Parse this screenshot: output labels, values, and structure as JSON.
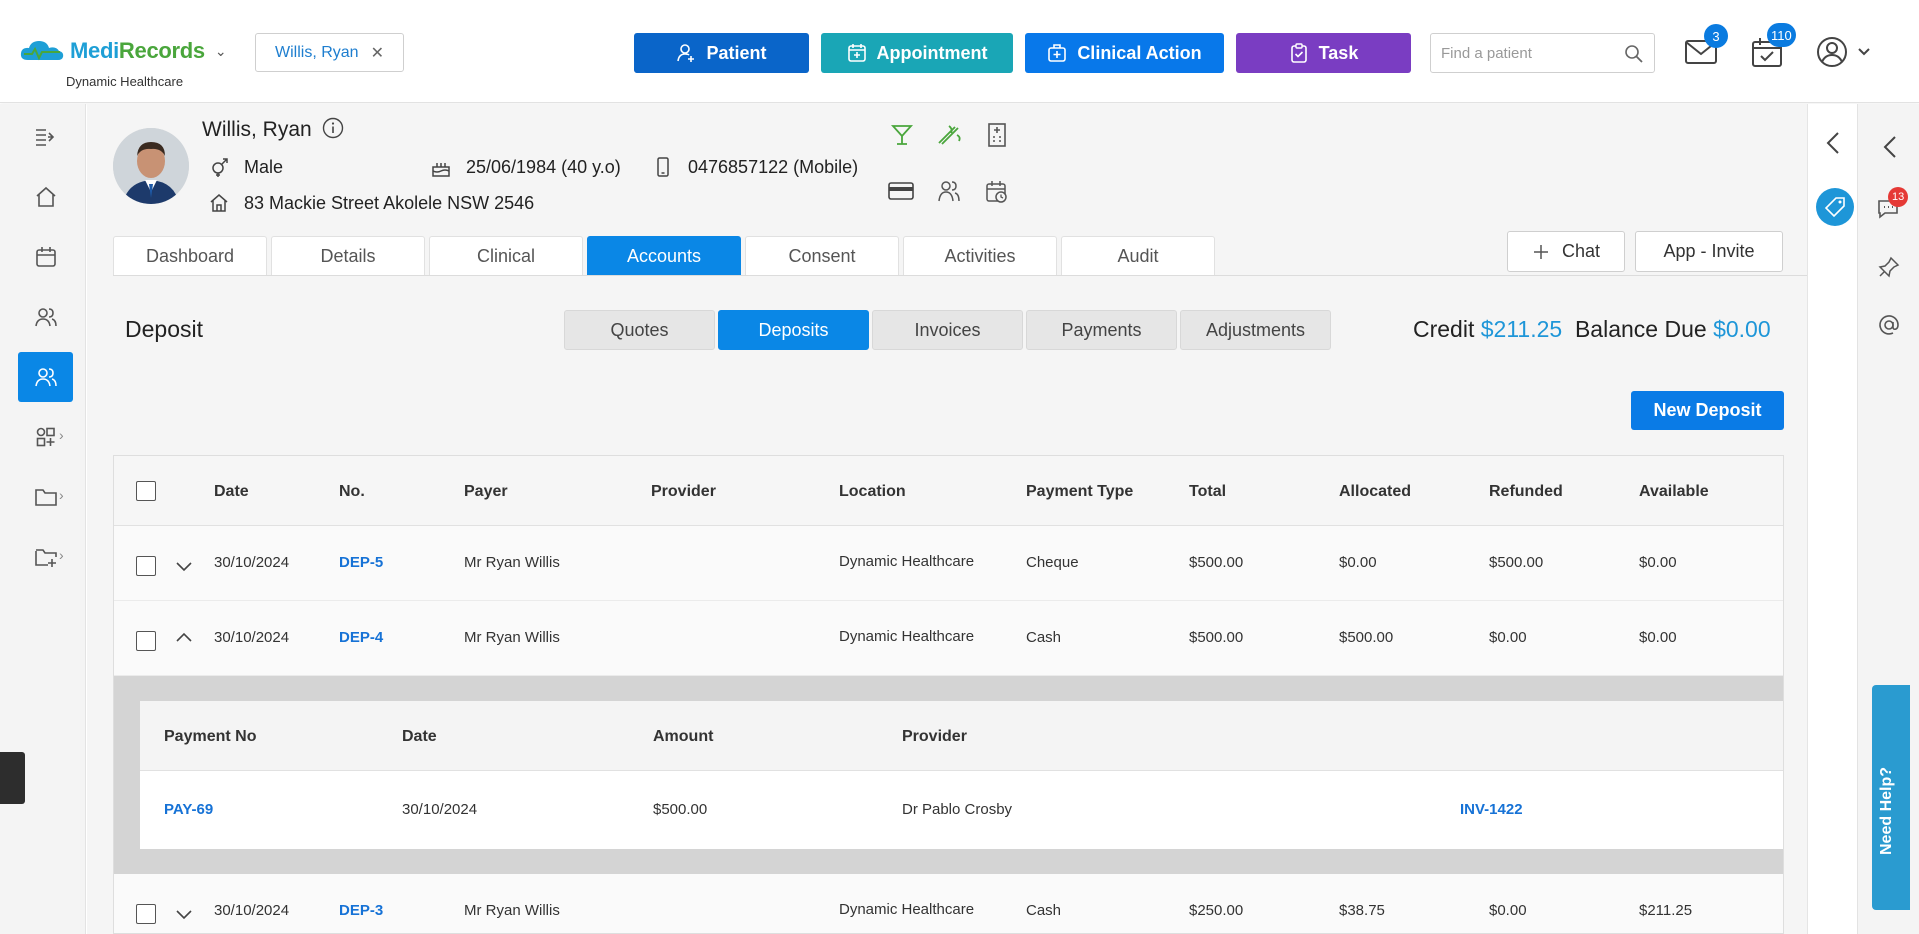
{
  "app": {
    "brand_part1": "Medi",
    "brand_part2": "Records",
    "org_name": "Dynamic Healthcare",
    "brand_blue": "#1e9fd6",
    "brand_green": "#4aa63c"
  },
  "header": {
    "patient_chip": "Willis, Ryan",
    "buttons": {
      "patient": "Patient",
      "appointment": "Appointment",
      "clinical_action": "Clinical Action",
      "task": "Task"
    },
    "search_placeholder": "Find a patient",
    "mail_count": "3",
    "tasks_count": "110"
  },
  "patient": {
    "name": "Willis, Ryan",
    "gender": "Male",
    "dob": "25/06/1984 (40 y.o)",
    "phone": "0476857122 (Mobile)",
    "address": "83 Mackie Street Akolele NSW 2546"
  },
  "tabs": [
    "Dashboard",
    "Details",
    "Clinical",
    "Accounts",
    "Consent",
    "Activities",
    "Audit"
  ],
  "active_tab": "Accounts",
  "chat_label": "Chat",
  "invite_label": "App - Invite",
  "section": {
    "title": "Deposit",
    "sub_tabs": [
      "Quotes",
      "Deposits",
      "Invoices",
      "Payments",
      "Adjustments"
    ],
    "active_sub_tab": "Deposits",
    "credit_label": "Credit",
    "credit_value": "$211.25",
    "balance_label": "Balance Due",
    "balance_value": "$0.00",
    "new_deposit_label": "New Deposit"
  },
  "table": {
    "columns": [
      "Date",
      "No.",
      "Payer",
      "Provider",
      "Location",
      "Payment Type",
      "Total",
      "Allocated",
      "Refunded",
      "Available"
    ],
    "rows": [
      {
        "date": "30/10/2024",
        "no": "DEP-5",
        "payer": "Mr Ryan Willis",
        "provider": "",
        "location": "Dynamic Healthcare",
        "type": "Cheque",
        "total": "$500.00",
        "allocated": "$0.00",
        "refunded": "$500.00",
        "available": "$0.00",
        "expanded": false
      },
      {
        "date": "30/10/2024",
        "no": "DEP-4",
        "payer": "Mr Ryan Willis",
        "provider": "",
        "location": "Dynamic Healthcare",
        "type": "Cash",
        "total": "$500.00",
        "allocated": "$500.00",
        "refunded": "$0.00",
        "available": "$0.00",
        "expanded": true
      },
      {
        "date": "30/10/2024",
        "no": "DEP-3",
        "payer": "Mr Ryan Willis",
        "provider": "",
        "location": "Dynamic Healthcare",
        "type": "Cash",
        "total": "$250.00",
        "allocated": "$38.75",
        "refunded": "$0.00",
        "available": "$211.25",
        "expanded": false
      }
    ],
    "sub_columns": [
      "Payment No",
      "Date",
      "Amount",
      "Provider"
    ],
    "sub_row": {
      "payment_no": "PAY-69",
      "date": "30/10/2024",
      "amount": "$500.00",
      "provider": "Dr Pablo Crosby",
      "invoice": "INV-1422"
    }
  },
  "right_panel": {
    "chat_badge": "13",
    "need_help": "Need Help?"
  }
}
